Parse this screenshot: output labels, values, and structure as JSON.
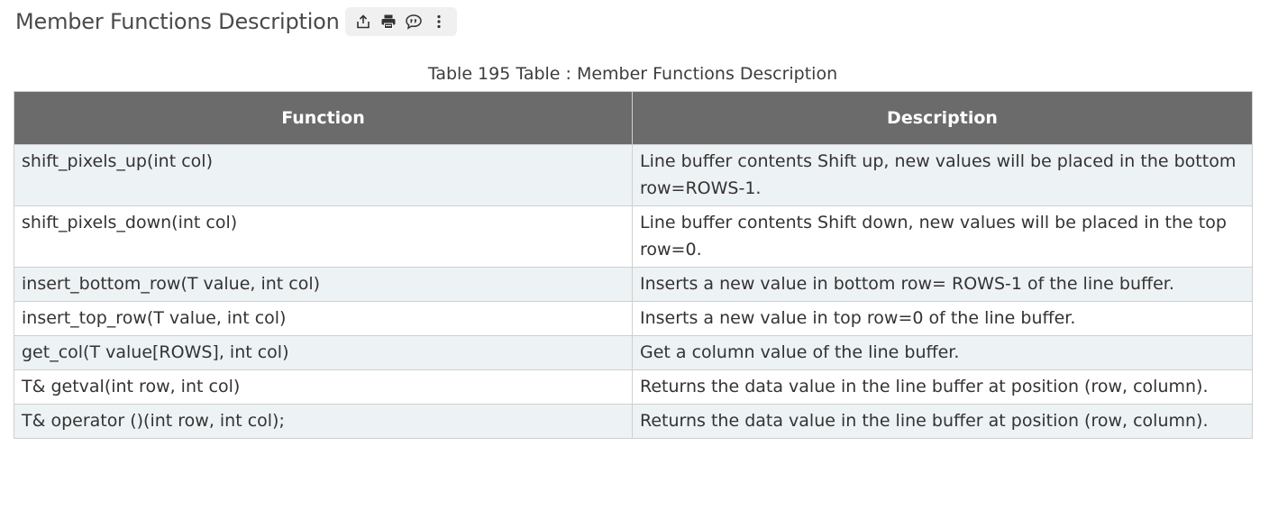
{
  "page": {
    "title": "Member Functions Description"
  },
  "toolbar": {
    "buttons": [
      {
        "name": "share-icon"
      },
      {
        "name": "print-icon"
      },
      {
        "name": "feedback-icon"
      },
      {
        "name": "more-icon"
      }
    ]
  },
  "table": {
    "caption": "Table 195 Table : Member Functions Description",
    "headers": [
      "Function",
      "Description"
    ],
    "rows": [
      {
        "function": "shift_pixels_up(int col)",
        "description": "Line buffer contents Shift up, new values will be placed in the bottom row=ROWS-1."
      },
      {
        "function": "shift_pixels_down(int col)",
        "description": "Line buffer contents Shift down, new values will be placed in the top row=0."
      },
      {
        "function": "insert_bottom_row(T value, int col)",
        "description": "Inserts a new value in bottom row= ROWS-1 of the line buffer."
      },
      {
        "function": "insert_top_row(T value, int col)",
        "description": "Inserts a new value in top row=0 of the line buffer."
      },
      {
        "function": "get_col(T value[ROWS], int col)",
        "description": "Get a column value of the line buffer."
      },
      {
        "function": "T& getval(int row, int col)",
        "description": "Returns the data value in the line buffer at position (row, column)."
      },
      {
        "function": "T& operator ()(int row, int col);",
        "description": "Returns the data value in the line buffer at position (row, column)."
      }
    ]
  }
}
